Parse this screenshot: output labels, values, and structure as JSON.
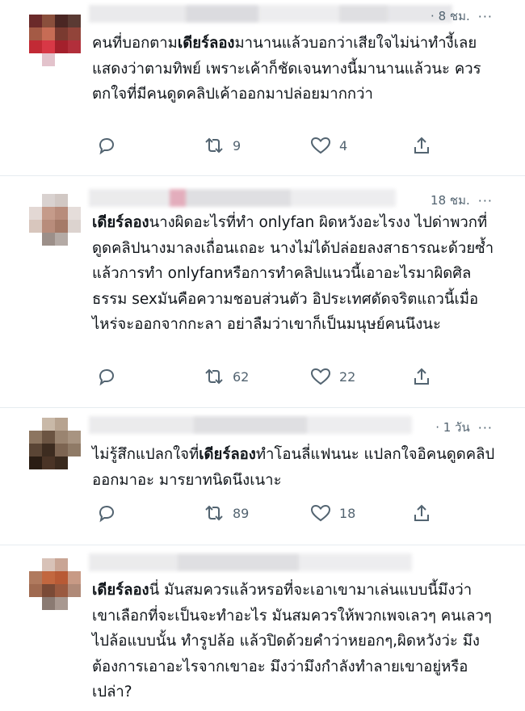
{
  "tweets": [
    {
      "time": "· 8 ชม.",
      "more": "···",
      "segments": [
        {
          "t": "คนที่บอกตาม",
          "b": false
        },
        {
          "t": "เดียร์ลอง",
          "b": true
        },
        {
          "t": "มานานแล้วบอกว่าเสียใจไม่น่าทำงี้เลย แสดงว่าตามทิพย์ เพราะเค้าก็ชัดเจนทางนี้มานานแล้วนะ ควรตกใจที่มีคนดูดคลิปเค้าออกมาปล่อยมากกว่า",
          "b": false
        }
      ],
      "retweets": "9",
      "likes": "4"
    },
    {
      "time": "18 ชม.",
      "more": "···",
      "segments": [
        {
          "t": "เดียร์ลอง",
          "b": true
        },
        {
          "t": "นางผิดอะไรที่ทำ onlyfan ผิดหวังอะไรงง ไปด่าพวกที่ดูดคลิปนางมาลงเถื่อนเถอะ นางไม่ได้ปล่อยลงสาธารณะด้วยซ้ำ แล้วการทำ onlyfanหรือการทำคลิปแนวนี้เอาอะไรมาผิดศิลธรรม sexมันคือความชอบส่วนตัว อิประเทศดัดจริตแถวนี้เมื่อไหร่จะออกจากกะลา อย่าลืมว่าเขาก็เป็นมนุษย์คนนึงนะ",
          "b": false
        }
      ],
      "retweets": "62",
      "likes": "22"
    },
    {
      "time": "· 1 วัน",
      "more": "···",
      "segments": [
        {
          "t": "ไม่รู้สึกแปลกใจที่",
          "b": false
        },
        {
          "t": "เดียร์ลอง",
          "b": true
        },
        {
          "t": "ทำโอนลี่แฟนนะ แปลกใจอิคนดูดคลิปออกมาอะ มารยาทนิดนึงเนาะ",
          "b": false
        }
      ],
      "retweets": "89",
      "likes": "18"
    },
    {
      "time": "",
      "more": "",
      "segments": [
        {
          "t": "เดียร์ลอง",
          "b": true
        },
        {
          "t": "นี่ มันสมควรแล้วหรอที่จะเอาเขามาเล่นแบบนี้มึงว่า เขาเลือกที่จะเป็นจะทำอะไร มันสมควรให้พวกเพจเลวๆ คนเลวๆ ไปล้อแบบนั้น ทำรูปล้อ แล้วปิดด้วยคำว่าหยอกๆ,ผิดหวังว่ะ มึงต้องการเอาอะไรจากเขาอะ มึงว่ามึงกำลังทำลายเขาอยู่หรือเปล่า?",
          "b": false
        }
      ],
      "retweets": "",
      "likes": ""
    }
  ],
  "icons": [
    "reply-icon",
    "retweet-icon",
    "like-icon",
    "share-icon"
  ],
  "colors": {
    "text": "#0f1419",
    "muted": "#536471",
    "divider": "#e6ecf0"
  }
}
